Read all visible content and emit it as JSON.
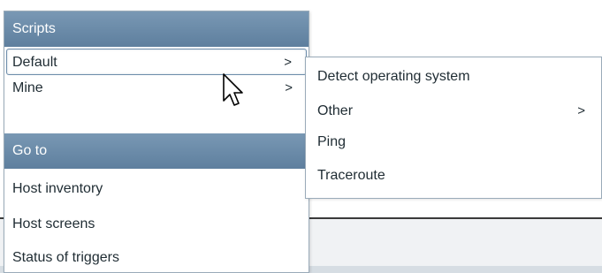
{
  "menu": {
    "scripts_header": "Scripts",
    "scripts_items": [
      {
        "label": "Default",
        "arrow": ">",
        "selected": true
      },
      {
        "label": "Mine",
        "arrow": ">"
      }
    ],
    "goto_header": "Go to",
    "goto_items": [
      {
        "label": "Host inventory"
      },
      {
        "label": "Host screens"
      },
      {
        "label": "Status of triggers"
      }
    ]
  },
  "submenu": {
    "items": [
      {
        "label": "Detect operating system"
      },
      {
        "label": "Other",
        "arrow": ">"
      },
      {
        "label": "Ping"
      },
      {
        "label": "Traceroute"
      }
    ]
  },
  "colors": {
    "header_bg": "#6a8aa8",
    "border": "#9aabb9",
    "text": "#1f2c33"
  },
  "icons": {
    "cursor": "arrow-cursor-icon",
    "submenu_arrow": "chevron-right-icon"
  }
}
